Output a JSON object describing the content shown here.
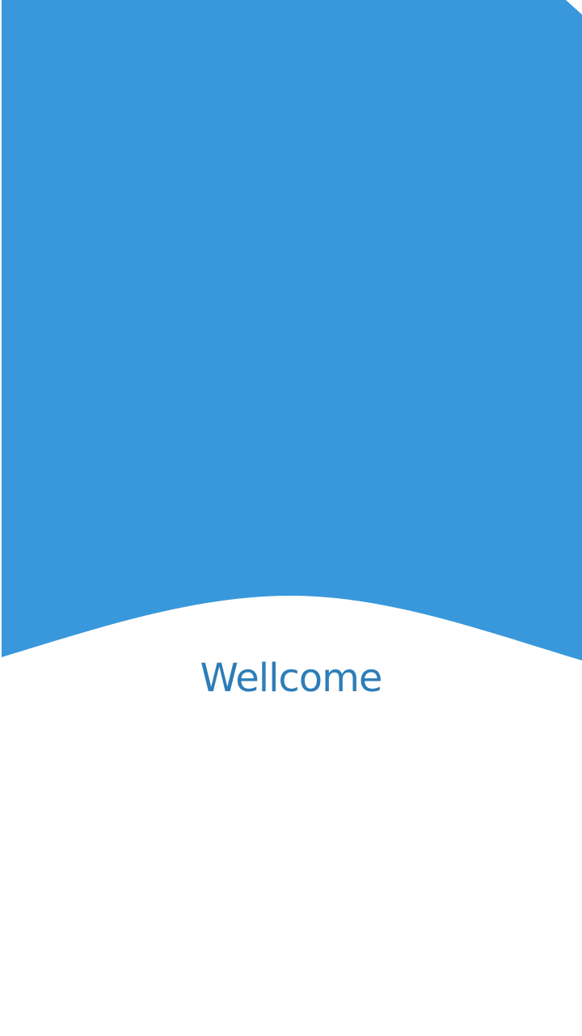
{
  "welcome": {
    "title": "Wellcome"
  },
  "colors": {
    "hero_background": "#3898DB",
    "title_text": "#2D7DB8",
    "page_background": "#FFFFFF"
  }
}
